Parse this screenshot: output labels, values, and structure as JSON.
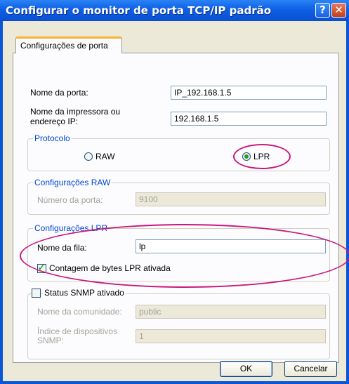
{
  "window": {
    "title": "Configurar o monitor de porta TCP/IP padrão",
    "help_label": "?",
    "close_label": "✕"
  },
  "tab": {
    "label": "Configurações de porta"
  },
  "port": {
    "name_label": "Nome da porta:",
    "name_value": "IP_192.168.1.5",
    "printer_label_line1": "Nome da impressora ou",
    "printer_label_line2": "endereço IP:",
    "printer_value": "192.168.1.5"
  },
  "protocol": {
    "legend": "Protocolo",
    "raw_label": "RAW",
    "lpr_label": "LPR",
    "selected": "LPR"
  },
  "raw_settings": {
    "legend": "Configurações RAW",
    "port_number_label": "Número da porta:",
    "port_number_value": "9100"
  },
  "lpr_settings": {
    "legend": "Configurações LPR",
    "queue_label": "Nome da fila:",
    "queue_value": "lp",
    "byte_count_label": "Contagem de bytes LPR ativada",
    "byte_count_checked": true
  },
  "snmp": {
    "legend": "Status SNMP ativado",
    "checked": false,
    "community_label": "Nome da comunidade:",
    "community_value": "public",
    "device_index_label_line1": "Índice de dispositivos",
    "device_index_label_line2": "SNMP:",
    "device_index_value": "1"
  },
  "buttons": {
    "ok": "OK",
    "cancel": "Cancelar"
  },
  "colors": {
    "title_bar": "#0e5fe6",
    "dialog_bg": "#ece9d8",
    "panel_bg": "#fcfcfe",
    "group_legend_blue": "#0046d5",
    "annotation_magenta": "#c8197a"
  }
}
